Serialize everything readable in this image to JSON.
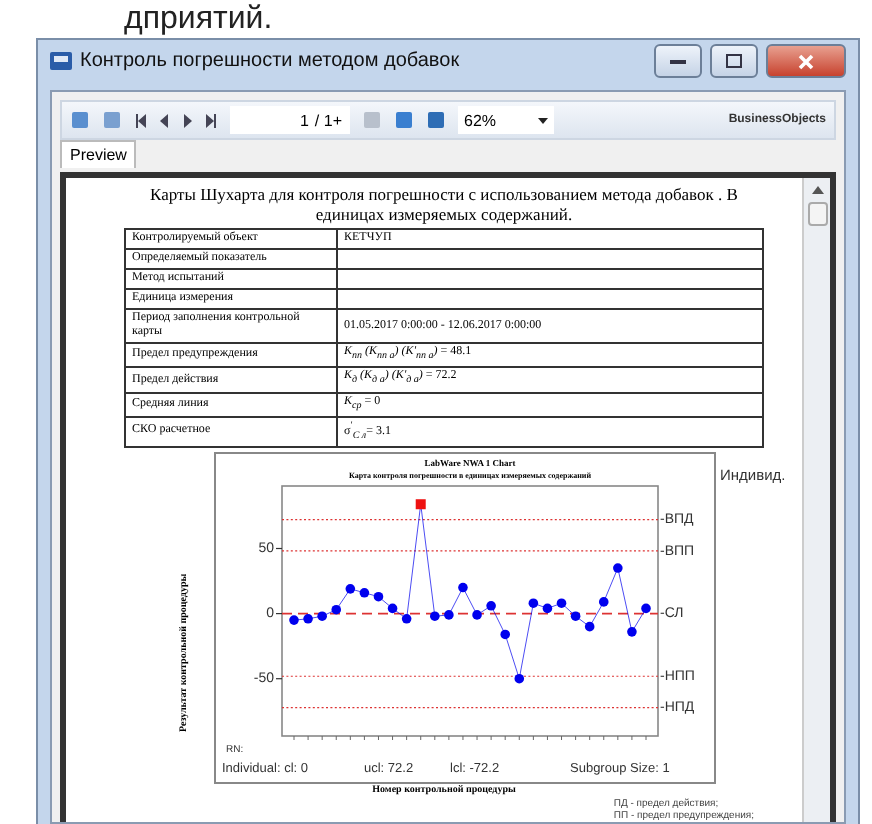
{
  "background_text": "дприятий.",
  "window": {
    "title": "Контроль погрешности методом добавок"
  },
  "toolbar": {
    "page": "1",
    "page_total": "/ 1+",
    "zoom": "62%",
    "brand": "BusinessObjects"
  },
  "tabs": [
    {
      "label": "Preview",
      "selected": true
    }
  ],
  "report": {
    "title": "Карты Шухарта для контроля погрешности с использованием метода добавок . В единицах измеряемых содержаний.",
    "rows": [
      {
        "label": "Контролируемый объект",
        "value": "КЕТЧУП"
      },
      {
        "label": "Определяемый показатель"
      },
      {
        "label": "Метод испытаний"
      },
      {
        "label": "Единица измерения"
      },
      {
        "label": "Период заполнения контрольной карты",
        "value": "01.05.2017  0:00:00 - 12.06.2017  0:00:00"
      },
      {
        "label": "Предел предупреждения",
        "value": "*K$_{пп}$ (K$_{пп а}$) (K'$_{пп а}$)* = 48.1"
      },
      {
        "label": "Предел действия",
        "value": "*K$_{д}$ (K$_{д а}$) (K'$_{д а}$)* = 72.2"
      },
      {
        "label": "Средняя линия",
        "value": "*K$_{ср}$* = 0"
      },
      {
        "label": "СКО расчетное",
        "value": "σ$^{′}$*$_{С л}$*= 3.1"
      }
    ],
    "chart": {
      "chart_data": {
        "type": "line",
        "title": "LabWare NWA 1 Chart",
        "subtitle": "Карта контроля погрешности в единицах измеряемых содержаний",
        "xlabel": "Номер контрольной процедуры",
        "ylabel": "Результат контрольной процедуры",
        "ylim": [
          -94,
          98
        ],
        "yticks": [
          -50,
          0,
          50
        ],
        "series": [
          {
            "color": "#0000ee",
            "marker": "circle",
            "values": [
              -5,
              -4,
              -2,
              3,
              19,
              16,
              13,
              4,
              -4,
              84,
              -2,
              -1,
              20,
              -1,
              6,
              -16,
              -50,
              8,
              4,
              8,
              -2,
              -10,
              9,
              35,
              -14,
              4
            ]
          }
        ],
        "ref_lines": [
          {
            "axis": "y",
            "label": "-ВПД",
            "value": 72.2
          },
          {
            "axis": "y",
            "label": "-ВПП",
            "value": 48.1
          },
          {
            "axis": "y",
            "label": "-СЛ",
            "value": 0
          },
          {
            "axis": "y",
            "label": "-НПП",
            "value": -48.1
          },
          {
            "axis": "y",
            "label": "-НПД",
            "value": -72.2
          }
        ]
      },
      "corner_label": "Индивид.",
      "rn_label": "RN:",
      "stats": [
        "Individual:  cl: 0",
        "ucl: 72.2",
        "lcl: -72.2",
        "Subgroup Size:  1"
      ]
    },
    "legend": [
      "ПД - предел действия;",
      "ПП - предел предупреждения;"
    ]
  }
}
